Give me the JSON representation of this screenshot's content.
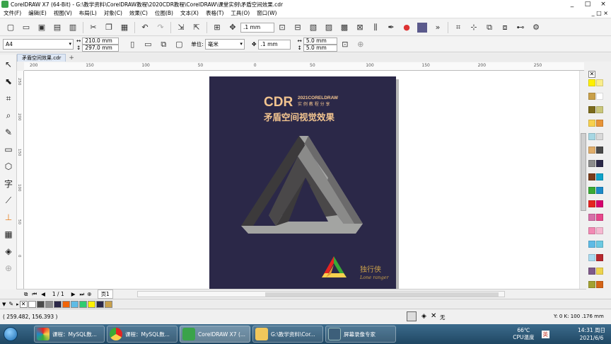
{
  "app": {
    "title": "CorelDRAW X7 (64-Bit) - G:\\教学资料\\CorelDRAW教程\\2020CDR教程\\CorelDRAW\\课堂实例\\矛盾空间效果.cdr",
    "window_buttons": [
      "_",
      "□",
      "×"
    ]
  },
  "menu": {
    "items": [
      "文件(F)",
      "编辑(E)",
      "视图(V)",
      "布局(L)",
      "对象(C)",
      "效果(C)",
      "位图(B)",
      "文本(X)",
      "表格(T)",
      "工具(O)",
      "窗口(W)"
    ],
    "right_buttons": [
      "_",
      "□",
      "×"
    ]
  },
  "toolbar1": {
    "nudge_value": ".1 mm"
  },
  "toolbar2": {
    "page_size": "A4",
    "width": "210.0 mm",
    "height": "297.0 mm",
    "units_label": "单位:",
    "units_value": "毫米",
    "nudge": ".1 mm",
    "dup_x": "5.0 mm",
    "dup_y": "5.0 mm"
  },
  "doc_tab": {
    "label": "矛盾空间效果.cdr",
    "add": "+"
  },
  "ruler": {
    "h_ticks": [
      "200",
      "150",
      "100",
      "50",
      "0",
      "50",
      "100",
      "150",
      "200",
      "250"
    ],
    "v_ticks": [
      "250",
      "200",
      "150",
      "100",
      "50",
      "0"
    ]
  },
  "poster": {
    "cdr": "CDR",
    "sub1": "2021CORELDRAW",
    "sub2": "实 例 教 程 分 享",
    "headline": "矛盾空间视觉效果",
    "brand_cn": "独行侠",
    "brand_en": "Lone ranger",
    "colors": {
      "background": "#2b2848",
      "text": "#f2c48f",
      "tri_dark": "#3c3a3b",
      "tri_mid": "#6b6a6b",
      "tri_light": "#a3a4a2"
    }
  },
  "page_nav": {
    "counter": "1 / 1",
    "page_tab": "页1"
  },
  "status": {
    "coords": "( 259.482, 156.393 )",
    "fill_none": "无",
    "color_readout": "Y: 0 K: 100 .176 mm"
  },
  "palette_colors": [
    "#fff000",
    "#f9ed8c",
    "#c9a04a",
    "#ffffff",
    "#7b6a1b",
    "#c9c67a",
    "#f7d14e",
    "#e89438",
    "#a7d7e3",
    "#d9d9d9",
    "#dfad6a",
    "#4a4a4a",
    "#8c8c8c",
    "#2b2848",
    "#7a3b1a",
    "#0fa3c9",
    "#3aaa35",
    "#1d8ac8",
    "#e52421",
    "#d6006f",
    "#d66fa8",
    "#e7478c",
    "#f28ab4",
    "#f5b9d1",
    "#5ebbe5",
    "#6bc9e1",
    "#a9dbf0",
    "#b7282e",
    "#7f5a8a",
    "#edd34e",
    "#a3a131",
    "#d56417"
  ],
  "doc_palette": [
    "#ffffff",
    "#4a4a4a",
    "#8c8c8c",
    "#2b2848",
    "#f0650b",
    "#5ebbe5",
    "#2ecc71",
    "#fff000",
    "#2b2848",
    "#c9a04a"
  ],
  "taskbar": {
    "items": [
      {
        "label": "课程：MySQL数..."
      },
      {
        "label": "课程：MySQL数..."
      },
      {
        "label": "CorelDRAW X7 (..."
      },
      {
        "label": "G:\\教学资料\\Cor..."
      },
      {
        "label": "屏幕录像专家"
      }
    ],
    "temp": "66℃",
    "temp_label": "CPU温度",
    "ime": "英",
    "time": "14:31 周日",
    "date": "2021/6/6"
  }
}
